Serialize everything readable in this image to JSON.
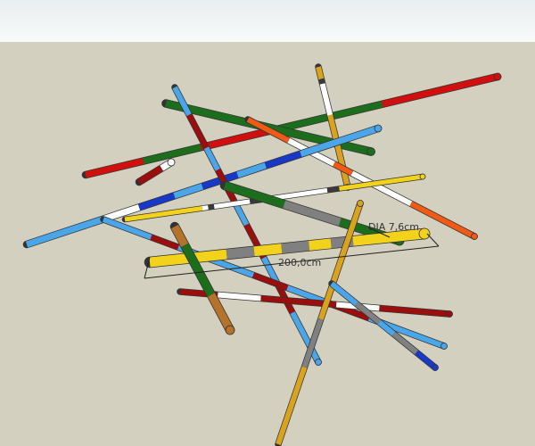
{
  "scene": {
    "colors": {
      "sky_top": "#e9eef0",
      "ground": "#d3d0bf",
      "red": "#d10f0f",
      "green": "#1c6e1c",
      "white": "#ffffff",
      "light_blue": "#4aa6e8",
      "blue": "#1838c8",
      "yellow": "#f2d21a",
      "gold": "#d9a320",
      "gray": "#808080",
      "dark": "#3a3a3a",
      "orange": "#f05a14",
      "dark_red": "#9b0e0e",
      "brown": "#b5722a",
      "dim_line": "#222222"
    },
    "annotations": {
      "diameter_label": "DIA 7,6cm",
      "length_label": "200,0cm"
    },
    "sticks": [
      {
        "name": "red-green-stick-top"
      },
      {
        "name": "green-stick-upper"
      },
      {
        "name": "gold-white-vertical-stick"
      },
      {
        "name": "white-orange-stick"
      },
      {
        "name": "blue-light-blue-stick"
      },
      {
        "name": "light-blue-dark-red-diagonal-stick"
      },
      {
        "name": "yellow-thin-stick"
      },
      {
        "name": "green-gray-stick"
      },
      {
        "name": "light-blue-lower-stick"
      },
      {
        "name": "yellow-gray-measured-stick"
      },
      {
        "name": "red-white-lower-stick"
      },
      {
        "name": "gold-gray-lower-stick"
      },
      {
        "name": "light-blue-gray-right-stick"
      },
      {
        "name": "brown-green-stick"
      },
      {
        "name": "short-dark-stick"
      }
    ]
  }
}
